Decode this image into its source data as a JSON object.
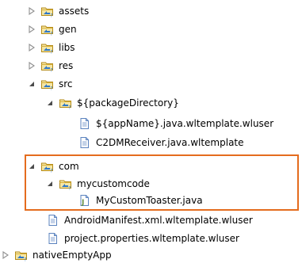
{
  "colors": {
    "highlight_border": "#e46c1e",
    "folder_icon": "#d8b13c",
    "package_icon": "#2d77c8",
    "file_icon": "#5a82be",
    "java_icon": "#5e8a3a"
  },
  "tree": {
    "rows": [
      {
        "label": "assets",
        "icon": "source-folder-icon",
        "toggle": "collapsed"
      },
      {
        "label": "gen",
        "icon": "source-folder-icon",
        "toggle": "collapsed"
      },
      {
        "label": "libs",
        "icon": "source-folder-icon",
        "toggle": "collapsed"
      },
      {
        "label": "res",
        "icon": "source-folder-icon",
        "toggle": "collapsed"
      },
      {
        "label": "src",
        "icon": "source-folder-icon",
        "toggle": "expanded"
      },
      {
        "label": "${packageDirectory}",
        "icon": "source-folder-icon",
        "toggle": "expanded"
      },
      {
        "label": "${appName}.java.wltemplate.wluser",
        "icon": "file-icon",
        "toggle": "none"
      },
      {
        "label": "C2DMReceiver.java.wltemplate",
        "icon": "file-icon",
        "toggle": "none"
      },
      {
        "label": "com",
        "icon": "source-folder-icon",
        "toggle": "expanded"
      },
      {
        "label": "mycustomcode",
        "icon": "source-folder-icon",
        "toggle": "expanded"
      },
      {
        "label": "MyCustomToaster.java",
        "icon": "java-file-icon",
        "toggle": "none"
      },
      {
        "label": "AndroidManifest.xml.wltemplate.wluser",
        "icon": "file-icon",
        "toggle": "none"
      },
      {
        "label": "project.properties.wltemplate.wluser",
        "icon": "file-icon",
        "toggle": "none"
      },
      {
        "label": "nativeEmptyApp",
        "icon": "source-folder-icon",
        "toggle": "collapsed"
      }
    ]
  }
}
